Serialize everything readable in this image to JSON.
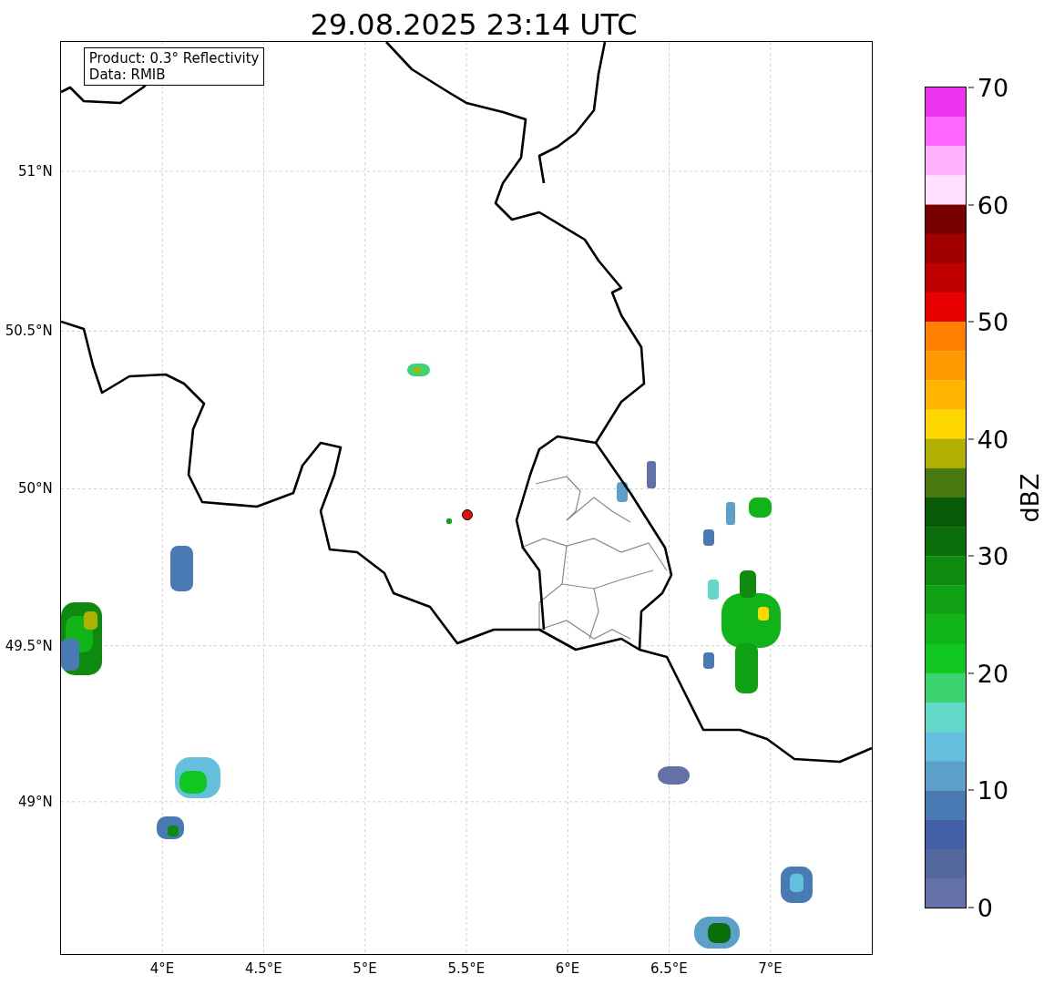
{
  "title": "29.08.2025 23:14 UTC",
  "info_box": [
    "Product: 0.3° Reflectivity",
    "Data: RMIB"
  ],
  "map": {
    "lat_labels": [
      "51°N",
      "50.5°N",
      "50°N",
      "49.5°N",
      "49°N"
    ],
    "lon_labels": [
      "4°E",
      "4.5°E",
      "5°E",
      "5.5°E",
      "6°E",
      "6.5°E",
      "7°E"
    ]
  },
  "colorbar": {
    "label": "dBZ",
    "ticks": [
      "70",
      "60",
      "50",
      "40",
      "30",
      "20",
      "10",
      "0"
    ],
    "bins": [
      {
        "color": "#ee33ee"
      },
      {
        "color": "#ff66ff"
      },
      {
        "color": "#ffb0ff"
      },
      {
        "color": "#ffe0ff"
      },
      {
        "color": "#780000"
      },
      {
        "color": "#a00000"
      },
      {
        "color": "#c00000"
      },
      {
        "color": "#e60000"
      },
      {
        "color": "#ff7f00"
      },
      {
        "color": "#ff9900"
      },
      {
        "color": "#ffb400"
      },
      {
        "color": "#ffd700"
      },
      {
        "color": "#b0b000"
      },
      {
        "color": "#4a7810"
      },
      {
        "color": "#085a08"
      },
      {
        "color": "#0a6e0a"
      },
      {
        "color": "#0e8a10"
      },
      {
        "color": "#10a014"
      },
      {
        "color": "#10b418"
      },
      {
        "color": "#10c820"
      },
      {
        "color": "#3cd470"
      },
      {
        "color": "#62d8c8"
      },
      {
        "color": "#64c0dc"
      },
      {
        "color": "#5aa0c8"
      },
      {
        "color": "#4a7ab4"
      },
      {
        "color": "#4460a8"
      },
      {
        "color": "#5468a0"
      },
      {
        "color": "#6470a8"
      }
    ]
  }
}
